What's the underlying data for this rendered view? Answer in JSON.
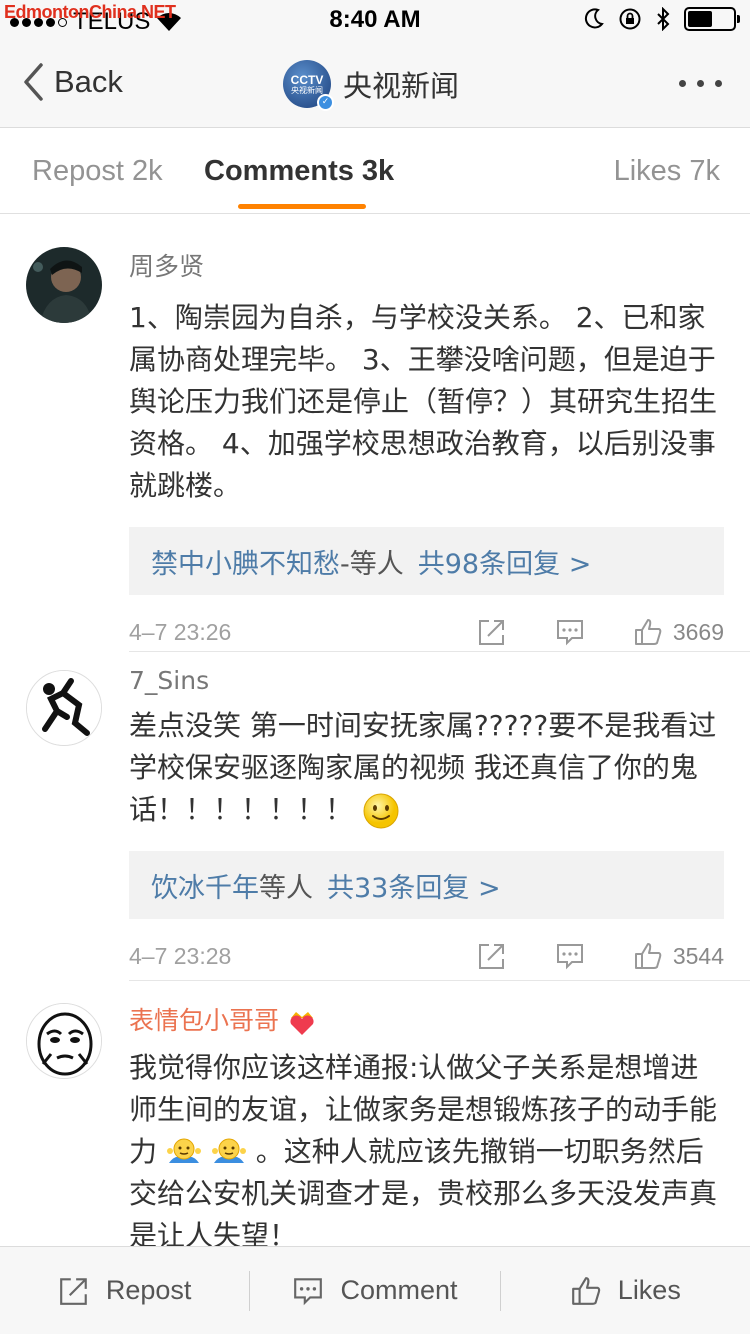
{
  "watermark": "EdmontonChina.NET",
  "status_bar": {
    "carrier": "TELUS",
    "time": "8:40 AM",
    "battery_level": 0.55
  },
  "nav": {
    "back_label": "Back",
    "title": "央视新闻",
    "logo_line1": "CCTV",
    "logo_line2": "央视新闻"
  },
  "tabs": {
    "repost": "Repost 2k",
    "comments": "Comments 3k",
    "likes": "Likes 7k"
  },
  "comments": [
    {
      "username": "周多贤",
      "text": "1、陶崇园为自杀，与学校没关系。 2、已和家属协商处理完毕。 3、王攀没啥问题，但是迫于舆论压力我们还是停止（暂停？）其研究生招生资格。 4、加强学校思想政治教育，以后别没事就跳楼。",
      "reply_names": "禁中小腆不知愁",
      "reply_mid": "-等人",
      "reply_count": "共98条回复 >",
      "time": "4–7 23:26",
      "likes": "3669"
    },
    {
      "username": "7_Sins",
      "text": "差点没笑 第一时间安抚家属?????要不是我看过学校保安驱逐陶家属的视频 我还真信了你的鬼话！！！！！！！",
      "reply_names": "饮冰千年",
      "reply_mid": "等人",
      "reply_count": "共33条回复 >",
      "time": "4–7 23:28",
      "likes": "3544"
    },
    {
      "username": "表情包小哥哥",
      "text_part1": "我觉得你应该这样通报:认做父子关系是想增进师生间的友谊，让做家务是想锻炼孩子的动手能力",
      "text_part2": "。这种人就应该先撤销一切职务然后交给公安机关调查才是，贵校那么多天没发声真是让人失望！"
    }
  ],
  "bottom_bar": {
    "repost": "Repost",
    "comment": "Comment",
    "likes": "Likes"
  },
  "colors": {
    "accent": "#ff8200",
    "link": "#4e7ca8",
    "vip_name": "#eb7350"
  }
}
